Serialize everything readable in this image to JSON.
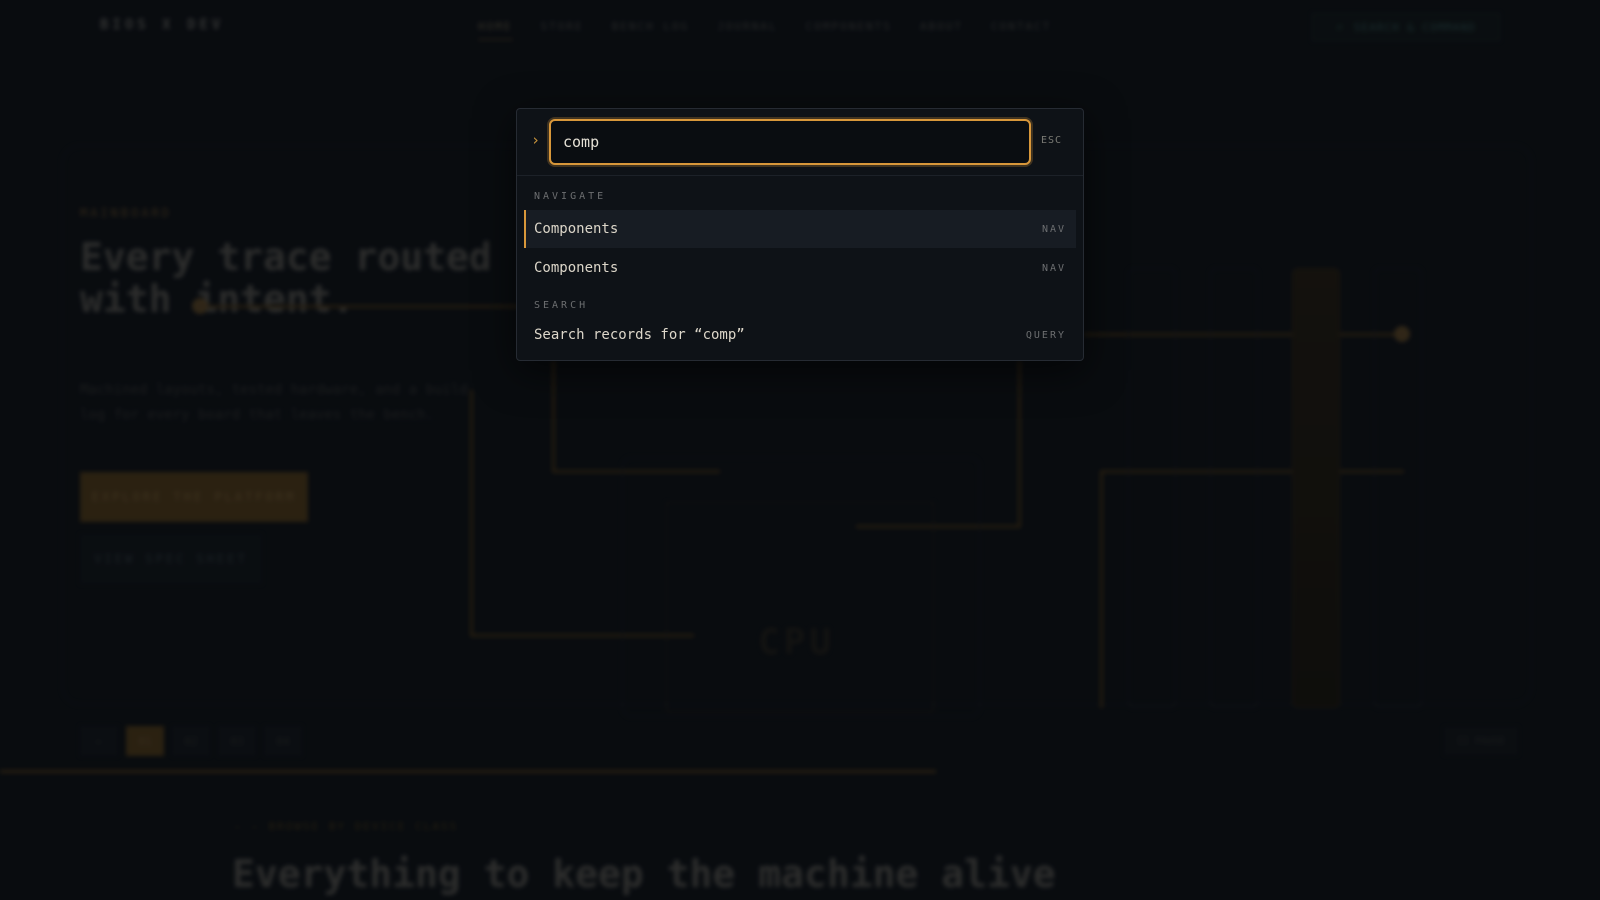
{
  "site": {
    "logo": "BIOS X DEV",
    "nav_links": [
      "HOME",
      "STORE",
      "BENCH LOG",
      "JOURNAL",
      "COMPONENTS",
      "ABOUT",
      "CONTACT"
    ],
    "command_button": "SEARCH & COMMAND"
  },
  "hero": {
    "eyebrow": "MAINBOARD",
    "title": "Every trace routed with intent.",
    "subtitle": "Machined layouts, tested hardware, and a build log for every board that leaves the bench.",
    "primary_cta": "EXPLORE THE PLATFORM",
    "secondary_cta": "VIEW SPEC SHEET",
    "chip_label": "CPU",
    "pager": [
      "←",
      "01",
      "02",
      "03",
      "04"
    ],
    "pause_label": "II PAUSE"
  },
  "section": {
    "eyebrow": "— — BROWSE BY DEVICE CLASS",
    "title": "Everything to keep the machine alive"
  },
  "palette": {
    "prompt_symbol": "›",
    "query": "comp",
    "esc_label": "ESC",
    "groups": [
      {
        "label": "NAVIGATE",
        "items": [
          {
            "label": "Components",
            "badge": "NAV",
            "selected": true
          },
          {
            "label": "Components",
            "badge": "NAV",
            "selected": false
          }
        ]
      },
      {
        "label": "SEARCH",
        "items": [
          {
            "label": "Search records for “comp”",
            "badge": "QUERY",
            "selected": false
          }
        ]
      }
    ]
  },
  "colors": {
    "accent": "#d8973a",
    "background": "#0b0e12",
    "panel": "#0e1217"
  }
}
